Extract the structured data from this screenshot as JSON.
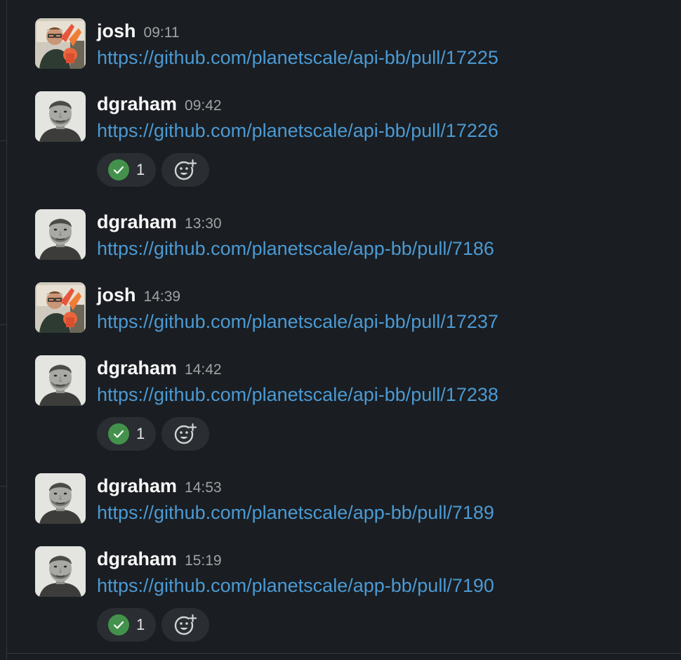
{
  "messages": [
    {
      "user": "josh",
      "time": "09:11",
      "link": "https://github.com/planetscale/api-bb/pull/17225",
      "avatar_icon": "avatar-josh",
      "reaction": null
    },
    {
      "user": "dgraham",
      "time": "09:42",
      "link": "https://github.com/planetscale/api-bb/pull/17226",
      "avatar_icon": "avatar-dgraham",
      "reaction": {
        "emoji": "white-check-mark-icon",
        "count": "1"
      }
    },
    {
      "user": "dgraham",
      "time": "13:30",
      "link": "https://github.com/planetscale/app-bb/pull/7186",
      "avatar_icon": "avatar-dgraham",
      "reaction": null
    },
    {
      "user": "josh",
      "time": "14:39",
      "link": "https://github.com/planetscale/api-bb/pull/17237",
      "avatar_icon": "avatar-josh",
      "reaction": null
    },
    {
      "user": "dgraham",
      "time": "14:42",
      "link": "https://github.com/planetscale/api-bb/pull/17238",
      "avatar_icon": "avatar-dgraham",
      "reaction": {
        "emoji": "white-check-mark-icon",
        "count": "1"
      }
    },
    {
      "user": "dgraham",
      "time": "14:53",
      "link": "https://github.com/planetscale/app-bb/pull/7189",
      "avatar_icon": "avatar-dgraham",
      "reaction": null
    },
    {
      "user": "dgraham",
      "time": "15:19",
      "link": "https://github.com/planetscale/app-bb/pull/7190",
      "avatar_icon": "avatar-dgraham",
      "reaction": {
        "emoji": "white-check-mark-icon",
        "count": "1"
      }
    }
  ],
  "colors": {
    "background": "#1a1d21",
    "link": "#4b9ad4",
    "username": "#f8f8f8",
    "timestamp": "#a1a2a4",
    "reaction_pill": "#2a2d31",
    "check_green": "#43924b"
  }
}
